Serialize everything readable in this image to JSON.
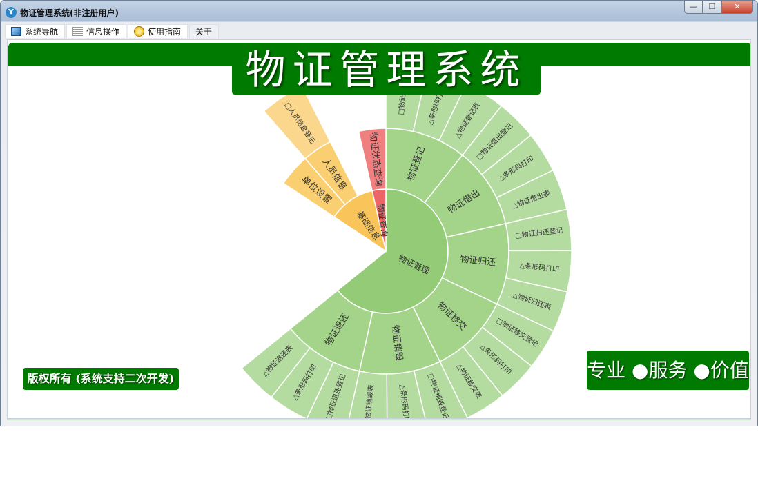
{
  "window": {
    "title": "物证管理系统(非注册用户)",
    "min": "—",
    "restore": "❐",
    "close": "✕"
  },
  "menu": [
    {
      "label": "系统导航",
      "icon": "monitor-icon"
    },
    {
      "label": "信息操作",
      "icon": "grid-icon"
    },
    {
      "label": "使用指南",
      "icon": "help-icon"
    },
    {
      "label": "关于",
      "icon": ""
    }
  ],
  "header": {
    "title": "物证管理系统"
  },
  "footer": {
    "copyright": "版权所有 (系统支持二次开发)",
    "slogan": "专业 ●服务 ●价值"
  },
  "colors": {
    "brand": "#007a00"
  },
  "chart_data": {
    "type": "sunburst",
    "note": "leaf units; unlabeled gap between 物证管理 and 基础信息",
    "nodes": [
      {
        "name": "物证管理",
        "value": 18,
        "colors": [
          "#93cb76",
          "#a3d48a",
          "#b4dca1"
        ],
        "children": [
          {
            "name": "物证登记",
            "value": 3,
            "children": [
              {
                "name": "□物证登记",
                "value": 1
              },
              {
                "name": "△条形码打印",
                "value": 1
              },
              {
                "name": "△物证登记表",
                "value": 1
              }
            ]
          },
          {
            "name": "物证借出",
            "value": 3,
            "children": [
              {
                "name": "□物证借出登记",
                "value": 1
              },
              {
                "name": "△条形码打印",
                "value": 1
              },
              {
                "name": "△物证借出表",
                "value": 1
              }
            ]
          },
          {
            "name": "物证归还",
            "value": 3,
            "children": [
              {
                "name": "□物证归还登记",
                "value": 1
              },
              {
                "name": "△条形码打印",
                "value": 1
              },
              {
                "name": "△物证归还表",
                "value": 1
              }
            ]
          },
          {
            "name": "物证移交",
            "value": 3,
            "children": [
              {
                "name": "□物证移交登记",
                "value": 1
              },
              {
                "name": "△条形码打印",
                "value": 1
              },
              {
                "name": "△物证移交表",
                "value": 1
              }
            ]
          },
          {
            "name": "物证销毁",
            "value": 3,
            "children": [
              {
                "name": "□物证销毁登记",
                "value": 1
              },
              {
                "name": "△条形码打印",
                "value": 1
              },
              {
                "name": "△物证销毁表",
                "value": 1
              }
            ]
          },
          {
            "name": "物证退还",
            "value": 3,
            "children": [
              {
                "name": "□物证退还登记",
                "value": 1
              },
              {
                "name": "△条形码打印",
                "value": 1
              },
              {
                "name": "△物证退还表",
                "value": 1
              }
            ]
          }
        ]
      },
      {
        "name": "基础信息",
        "value": 3.4,
        "colors": [
          "#f9c55a",
          "#f9cf72",
          "#fad78c"
        ],
        "children": [
          {
            "name": "单位设置",
            "value": 1.2,
            "children": []
          },
          {
            "name": "人员信息",
            "value": 1.1,
            "children": [
              {
                "name": "□人员信息登记",
                "value": 1.1
              }
            ]
          }
        ]
      },
      {
        "name": "物证查询",
        "value": 1,
        "colors": [
          "#ee6566",
          "#f08080",
          "#f29a9a"
        ],
        "children": [
          {
            "name": "物证状态查询",
            "value": 1,
            "children": []
          }
        ]
      }
    ]
  }
}
